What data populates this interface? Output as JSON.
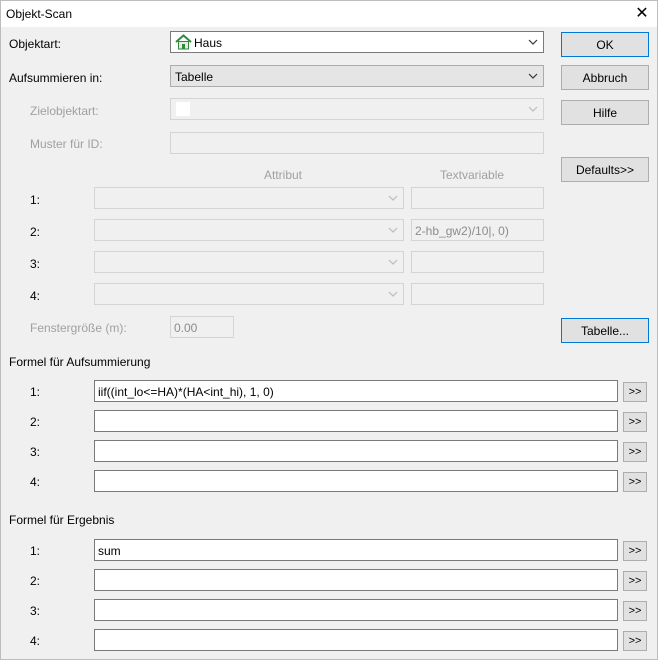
{
  "window": {
    "title": "Objekt-Scan",
    "close_glyph": "✕"
  },
  "objektart": {
    "label": "Objektart:",
    "value": "Haus",
    "icon": "house-icon"
  },
  "aufsummieren": {
    "label": "Aufsummieren in:",
    "value": "Tabelle"
  },
  "zielobjektart": {
    "label": "Zielobjektart:"
  },
  "muster": {
    "label": "Muster für ID:"
  },
  "attr_header": {
    "attribut": "Attribut",
    "textvariable": "Textvariable"
  },
  "attr_rows": [
    {
      "label": "1:",
      "textvariable": ""
    },
    {
      "label": "2:",
      "textvariable": "2-hb_gw2)/10|, 0)"
    },
    {
      "label": "3:",
      "textvariable": ""
    },
    {
      "label": "4:",
      "textvariable": ""
    }
  ],
  "fenster": {
    "label": "Fenstergröße (m):",
    "value": "0.00"
  },
  "buttons": {
    "ok": "OK",
    "abbruch": "Abbruch",
    "hilfe": "Hilfe",
    "defaults": "Defaults>>",
    "tabelle": "Tabelle..."
  },
  "aufsummierung": {
    "heading": "Formel für Aufsummierung",
    "rows": [
      {
        "label": "1:",
        "value": "iif((int_lo<=HA)*(HA<int_hi), 1, 0)",
        "btn": ">>"
      },
      {
        "label": "2:",
        "value": "",
        "btn": ">>"
      },
      {
        "label": "3:",
        "value": "",
        "btn": ">>"
      },
      {
        "label": "4:",
        "value": "",
        "btn": ">>"
      }
    ]
  },
  "ergebnis": {
    "heading": "Formel für Ergebnis",
    "rows": [
      {
        "label": "1:",
        "value": "sum",
        "btn": ">>"
      },
      {
        "label": "2:",
        "value": "",
        "btn": ">>"
      },
      {
        "label": "3:",
        "value": "",
        "btn": ">>"
      },
      {
        "label": "4:",
        "value": "",
        "btn": ">>"
      }
    ]
  },
  "colors": {
    "focus_border": "#0078d7",
    "house_roof": "#2e8b3a",
    "house_body": "#e8e8e8"
  }
}
